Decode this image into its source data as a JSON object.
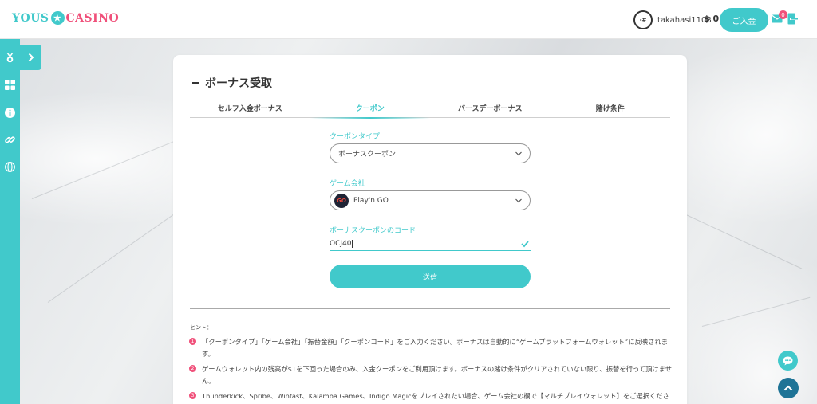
{
  "header": {
    "logo_part1": "YOUS",
    "logo_part2": "CASINO",
    "avatar_text": "-#",
    "username": "takahasi1108",
    "balance": "$ 0",
    "deposit_label": "ご入金",
    "mail_count": "0"
  },
  "sidebar": {
    "items": [
      "medal-icon",
      "grid-icon",
      "info-icon",
      "link-icon",
      "globe-icon"
    ]
  },
  "page": {
    "title": "ボーナス受取",
    "tabs": [
      {
        "label": "セルフ入金ボーナス",
        "active": false
      },
      {
        "label": "クーポン",
        "active": true
      },
      {
        "label": "バースデーボーナス",
        "active": false
      },
      {
        "label": "賭け条件",
        "active": false
      }
    ]
  },
  "form": {
    "coupon_type_label": "クーポンタイプ",
    "coupon_type_value": "ボーナスクーポン",
    "game_provider_label": "ゲーム会社",
    "game_provider_logo": "GO",
    "game_provider_value": "Play'n GO",
    "coupon_code_label": "ボーナスクーポンのコード",
    "coupon_code_value": "OCJ40",
    "submit_label": "送信"
  },
  "hints": {
    "title": "ヒント：",
    "items": [
      {
        "num": "1",
        "text": "「クーポンタイプ」「ゲーム会社」「振替金額」「クーポンコード」をご入力ください。ボーナスは自動的に“ゲームプラットフォームウォレット”に反映されます。"
      },
      {
        "num": "2",
        "text": "ゲームウォレット内の残高が$1を下回った場合のみ、入金クーポンをご利用頂けます。ボーナスの賭け条件がクリアされていない限り、振替を行って頂けません。"
      },
      {
        "num": "3",
        "text": "Thunderkick、Spribe、Winfast、Kalamba Games、Indigo Magicをプレイされたい場合、ゲーム会社の欄で【マルチプレイウォレット】をご選択ください。"
      }
    ]
  },
  "colors": {
    "accent": "#41c9cb",
    "pink": "#f0507a",
    "dark_blue": "#1e7396"
  }
}
